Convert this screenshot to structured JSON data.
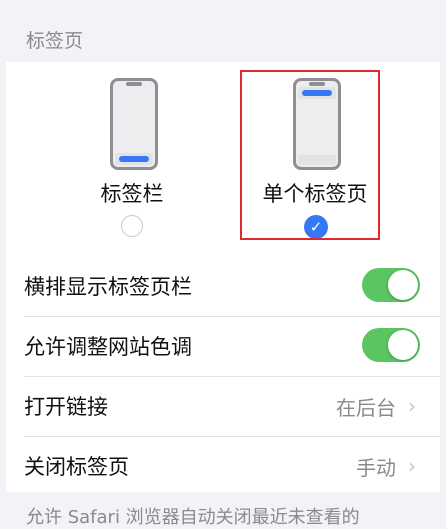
{
  "section": {
    "header": "标签页"
  },
  "layout_options": {
    "tab_bar": {
      "label": "标签栏",
      "selected": false
    },
    "single_tab": {
      "label": "单个标签页",
      "selected": true
    }
  },
  "settings": {
    "landscape_tab_bar": {
      "label": "横排显示标签页栏",
      "on": true
    },
    "website_tinting": {
      "label": "允许调整网站色调",
      "on": true
    },
    "open_links": {
      "label": "打开链接",
      "value": "在后台"
    },
    "close_tabs": {
      "label": "关闭标签页",
      "value": "手动"
    }
  },
  "footer": {
    "text": "允许 Safari 浏览器自动关闭最近未查看的"
  },
  "colors": {
    "accent": "#3478f6",
    "toggle_on": "#5ac561",
    "highlight": "#e0282e"
  }
}
